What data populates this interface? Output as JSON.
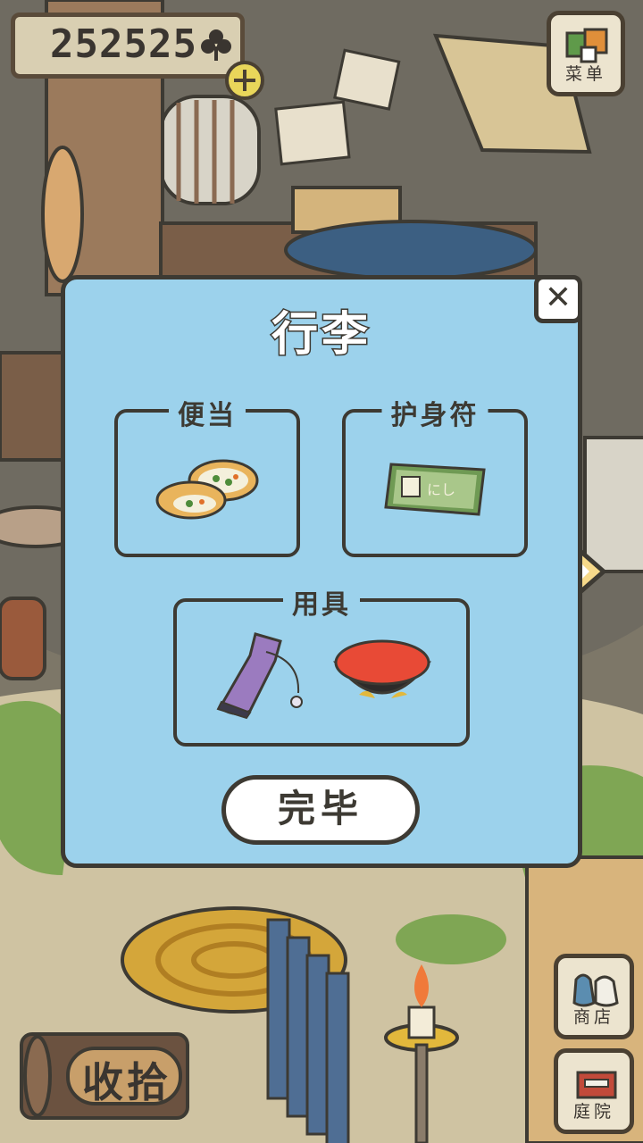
{
  "currency": {
    "amount": "252525",
    "icon": "clover-icon"
  },
  "menu_button": {
    "label": "菜单"
  },
  "shop_button": {
    "label": "商店"
  },
  "yard_button": {
    "label": "庭院"
  },
  "collect_button": {
    "label": "收拾"
  },
  "dialog": {
    "title": "行李",
    "slots": {
      "bento": {
        "label": "便当"
      },
      "charm": {
        "label": "护身符",
        "charm_text": "にし"
      },
      "tools": {
        "label": "用具"
      }
    },
    "done_label": "完毕"
  },
  "colors": {
    "dialog_bg": "#9cd2ec",
    "outline": "#3d3a33",
    "accent_yellow": "#e9d65a"
  }
}
